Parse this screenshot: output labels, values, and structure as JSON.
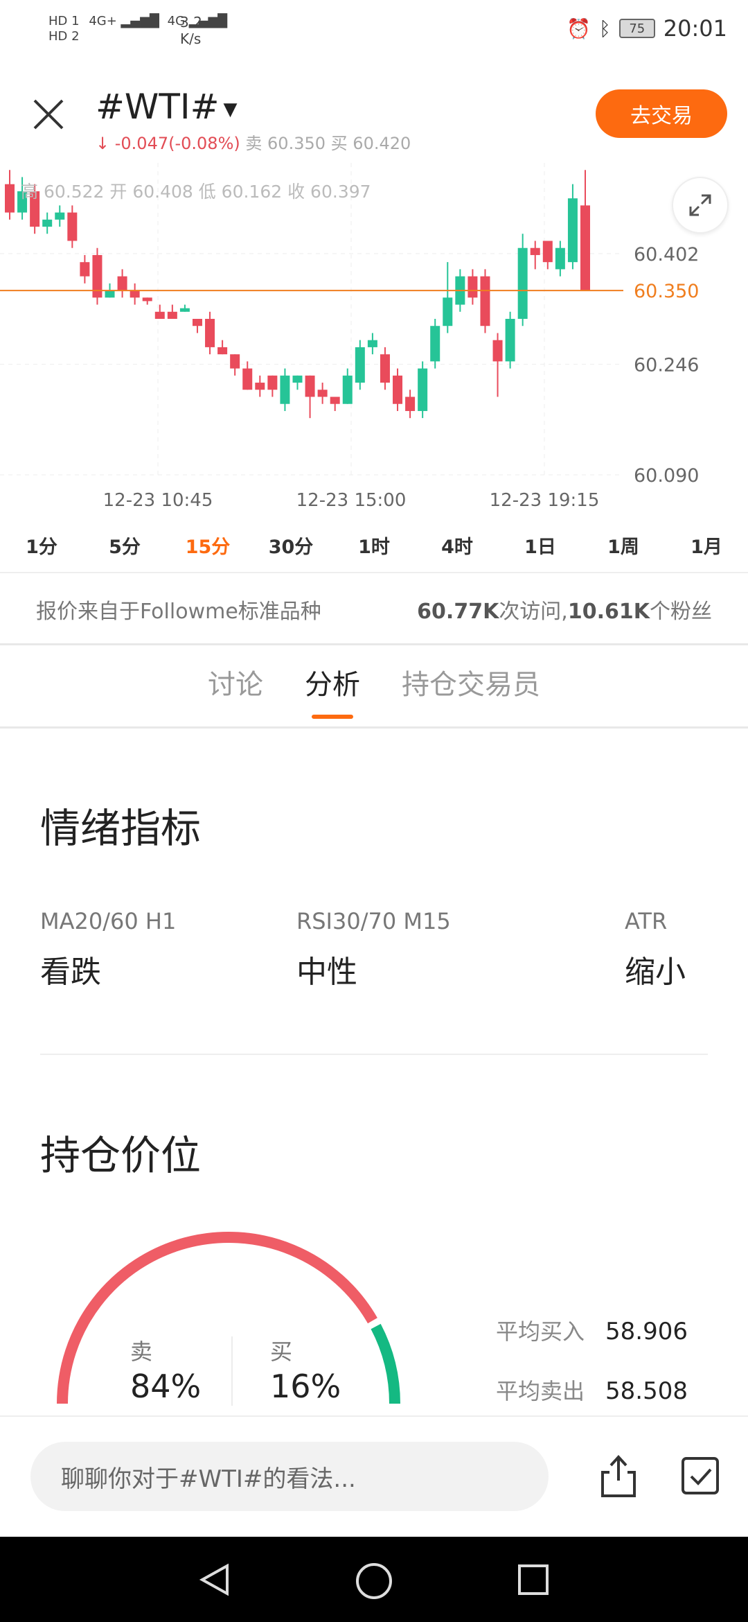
{
  "status_bar": {
    "hd1": "HD 1",
    "hd2": "HD 2",
    "net1": "4G+",
    "net2": "4G",
    "speed": "3.2",
    "speed_unit": "K/s",
    "battery": "75",
    "time": "20:01"
  },
  "header": {
    "symbol": "#WTI#",
    "change_arrow": "↓",
    "change": "-0.047(-0.08%)",
    "sell_label": "卖",
    "sell_price": "60.350",
    "buy_label": "买",
    "buy_price": "60.420",
    "trade_button": "去交易"
  },
  "chart_data": {
    "type": "candlestick",
    "ohlc_header": "高 60.522  开 60.408  低 60.162  收 60.397",
    "y_ticks": [
      "60.402",
      "60.350",
      "60.246",
      "60.090"
    ],
    "current_price": "60.350",
    "x_ticks": [
      "12-23 10:45",
      "12-23 15:00",
      "12-23 19:15"
    ],
    "colors": {
      "up": "#26c497",
      "down": "#e94b5b",
      "price_line": "#f07e1f"
    },
    "candles": [
      {
        "o": 60.5,
        "c": 60.46,
        "h": 60.52,
        "l": 60.45
      },
      {
        "o": 60.46,
        "c": 60.49,
        "h": 60.51,
        "l": 60.45
      },
      {
        "o": 60.49,
        "c": 60.44,
        "h": 60.5,
        "l": 60.43
      },
      {
        "o": 60.44,
        "c": 60.45,
        "h": 60.46,
        "l": 60.43
      },
      {
        "o": 60.45,
        "c": 60.46,
        "h": 60.47,
        "l": 60.44
      },
      {
        "o": 60.46,
        "c": 60.42,
        "h": 60.47,
        "l": 60.41
      },
      {
        "o": 60.39,
        "c": 60.37,
        "h": 60.4,
        "l": 60.36
      },
      {
        "o": 60.4,
        "c": 60.34,
        "h": 60.41,
        "l": 60.33
      },
      {
        "o": 60.34,
        "c": 60.35,
        "h": 60.36,
        "l": 60.34
      },
      {
        "o": 60.37,
        "c": 60.35,
        "h": 60.38,
        "l": 60.34
      },
      {
        "o": 60.35,
        "c": 60.34,
        "h": 60.36,
        "l": 60.33
      },
      {
        "o": 60.34,
        "c": 60.335,
        "h": 60.34,
        "l": 60.33
      },
      {
        "o": 60.32,
        "c": 60.31,
        "h": 60.33,
        "l": 60.31
      },
      {
        "o": 60.32,
        "c": 60.31,
        "h": 60.33,
        "l": 60.31
      },
      {
        "o": 60.32,
        "c": 60.325,
        "h": 60.33,
        "l": 60.32
      },
      {
        "o": 60.31,
        "c": 60.3,
        "h": 60.31,
        "l": 60.29
      },
      {
        "o": 60.31,
        "c": 60.27,
        "h": 60.32,
        "l": 60.26
      },
      {
        "o": 60.27,
        "c": 60.26,
        "h": 60.28,
        "l": 60.26
      },
      {
        "o": 60.26,
        "c": 60.24,
        "h": 60.26,
        "l": 60.23
      },
      {
        "o": 60.24,
        "c": 60.21,
        "h": 60.25,
        "l": 60.21
      },
      {
        "o": 60.22,
        "c": 60.21,
        "h": 60.23,
        "l": 60.2
      },
      {
        "o": 60.23,
        "c": 60.21,
        "h": 60.23,
        "l": 60.2
      },
      {
        "o": 60.19,
        "c": 60.23,
        "h": 60.24,
        "l": 60.18
      },
      {
        "o": 60.22,
        "c": 60.23,
        "h": 60.23,
        "l": 60.21
      },
      {
        "o": 60.23,
        "c": 60.2,
        "h": 60.23,
        "l": 60.17
      },
      {
        "o": 60.21,
        "c": 60.2,
        "h": 60.22,
        "l": 60.19
      },
      {
        "o": 60.2,
        "c": 60.19,
        "h": 60.2,
        "l": 60.18
      },
      {
        "o": 60.19,
        "c": 60.23,
        "h": 60.24,
        "l": 60.19
      },
      {
        "o": 60.22,
        "c": 60.27,
        "h": 60.28,
        "l": 60.21
      },
      {
        "o": 60.27,
        "c": 60.28,
        "h": 60.29,
        "l": 60.26
      },
      {
        "o": 60.26,
        "c": 60.22,
        "h": 60.27,
        "l": 60.21
      },
      {
        "o": 60.23,
        "c": 60.19,
        "h": 60.24,
        "l": 60.18
      },
      {
        "o": 60.2,
        "c": 60.18,
        "h": 60.21,
        "l": 60.17
      },
      {
        "o": 60.18,
        "c": 60.24,
        "h": 60.25,
        "l": 60.17
      },
      {
        "o": 60.25,
        "c": 60.3,
        "h": 60.31,
        "l": 60.24
      },
      {
        "o": 60.3,
        "c": 60.34,
        "h": 60.39,
        "l": 60.29
      },
      {
        "o": 60.33,
        "c": 60.37,
        "h": 60.38,
        "l": 60.32
      },
      {
        "o": 60.37,
        "c": 60.34,
        "h": 60.38,
        "l": 60.33
      },
      {
        "o": 60.37,
        "c": 60.3,
        "h": 60.38,
        "l": 60.29
      },
      {
        "o": 60.28,
        "c": 60.25,
        "h": 60.29,
        "l": 60.2
      },
      {
        "o": 60.25,
        "c": 60.31,
        "h": 60.32,
        "l": 60.24
      },
      {
        "o": 60.31,
        "c": 60.41,
        "h": 60.43,
        "l": 60.3
      },
      {
        "o": 60.41,
        "c": 60.4,
        "h": 60.42,
        "l": 60.38
      },
      {
        "o": 60.42,
        "c": 60.39,
        "h": 60.42,
        "l": 60.38
      },
      {
        "o": 60.38,
        "c": 60.41,
        "h": 60.42,
        "l": 60.37
      },
      {
        "o": 60.39,
        "c": 60.48,
        "h": 60.5,
        "l": 60.38
      },
      {
        "o": 60.47,
        "c": 60.35,
        "h": 60.52,
        "l": 60.35
      }
    ]
  },
  "intervals": [
    "1分",
    "5分",
    "15分",
    "30分",
    "1时",
    "4时",
    "1日",
    "1周",
    "1月"
  ],
  "active_interval": "15分",
  "info": {
    "source": "报价来自于Followme标准品种",
    "visits_num": "60.77K",
    "visits_label": "次访问,",
    "fans_num": "10.61K",
    "fans_label": "个粉丝"
  },
  "tabs": [
    "讨论",
    "分析",
    "持仓交易员"
  ],
  "active_tab": "分析",
  "sentiment": {
    "title": "情绪指标",
    "indicators": [
      {
        "label": "MA20/60 H1",
        "value": "看跌"
      },
      {
        "label": "RSI30/70 M15",
        "value": "中性"
      },
      {
        "label": "ATR",
        "value": "缩小"
      }
    ]
  },
  "positions": {
    "title": "持仓价位",
    "sell_label": "卖",
    "sell_pct": "84%",
    "buy_label": "买",
    "buy_pct": "16%",
    "sell_fraction": 0.84,
    "colors": {
      "sell": "#ef5d66",
      "buy": "#14b982"
    },
    "avg_buy_label": "平均买入",
    "avg_buy_value": "58.906",
    "avg_sell_label": "平均卖出",
    "avg_sell_value": "58.508"
  },
  "bottom": {
    "placeholder": "聊聊你对于#WTI#的看法..."
  }
}
